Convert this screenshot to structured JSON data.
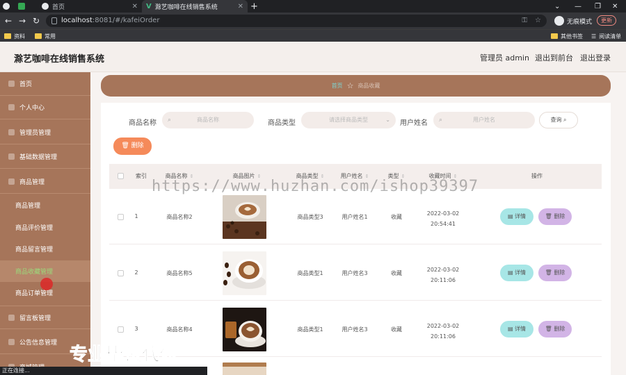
{
  "browser": {
    "tabs": [
      {
        "label": ""
      },
      {
        "label": ""
      },
      {
        "label": "首页"
      },
      {
        "label": "滁艺咖啡在线销售系统"
      }
    ],
    "url_host": "localhost",
    "url_path": ":8081/#/kafeiOrder",
    "incognito_label": "无痕模式",
    "update_label": "更新",
    "bookmarks": [
      "资料",
      "常用"
    ],
    "bookmarks_right": [
      "其他书签",
      "阅读清单"
    ],
    "status_text": "正在连接..."
  },
  "header": {
    "title": "滁艺咖啡在线销售系统",
    "admin": "管理员 admin",
    "front": "退出到前台",
    "logout": "退出登录"
  },
  "sidebar": {
    "items": [
      {
        "label": "首页",
        "icon": "home-icon"
      },
      {
        "label": "个人中心",
        "icon": "user-icon"
      },
      {
        "label": "管理员管理",
        "icon": "admin-icon"
      },
      {
        "label": "基础数据管理",
        "icon": "data-icon"
      },
      {
        "label": "商品管理",
        "icon": "goods-icon"
      }
    ],
    "sub_items": [
      "商品管理",
      "商品评价管理",
      "商品留言管理",
      "商品收藏管理",
      "商品订单管理"
    ],
    "items_after": [
      {
        "label": "留言板管理",
        "icon": "board-icon"
      },
      {
        "label": "公告信息管理",
        "icon": "notice-icon"
      },
      {
        "label": "商城管理",
        "icon": "mall-icon"
      }
    ]
  },
  "breadcrumb": {
    "home": "首页",
    "current": "商品收藏"
  },
  "filters": {
    "name_label": "商品名称",
    "name_placeholder": "商品名称",
    "type_label": "商品类型",
    "type_placeholder": "请选择商品类型",
    "user_label": "用户姓名",
    "user_placeholder": "用户姓名",
    "query_label": "查询"
  },
  "batch_delete_label": "删除",
  "table": {
    "columns": [
      "索引",
      "商品名称",
      "商品图片",
      "商品类型",
      "用户姓名",
      "类型",
      "收藏时间",
      "操作"
    ],
    "rows": [
      {
        "index": "1",
        "name": "商品名称2",
        "type": "商品类型3",
        "user": "用户姓名1",
        "kind": "收藏",
        "date": "2022-03-02",
        "time": "20:54:41"
      },
      {
        "index": "2",
        "name": "商品名称5",
        "type": "商品类型1",
        "user": "用户姓名3",
        "kind": "收藏",
        "date": "2022-03-02",
        "time": "20:11:06"
      },
      {
        "index": "3",
        "name": "商品名称4",
        "type": "商品类型1",
        "user": "用户姓名3",
        "kind": "收藏",
        "date": "2022-03-02",
        "time": "20:11:06"
      }
    ],
    "detail_label": "详情",
    "delete_label": "删除"
  },
  "overlays": {
    "watermark": "https://www.huzhan.com/ishop39397",
    "promo": "专业毕设代做"
  },
  "colors": {
    "sidebar": "#a6755a",
    "accent_delete": "#f58a5a",
    "detail_btn": "#a7e6e6",
    "delete_btn": "#d2b4e6"
  }
}
